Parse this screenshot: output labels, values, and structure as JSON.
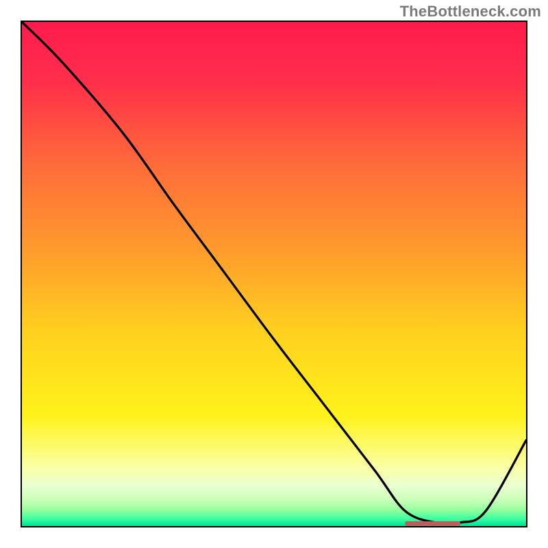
{
  "watermark": "TheBottleneck.com",
  "gradient": {
    "stops": [
      {
        "offset": "0%",
        "color": "#ff1a4d"
      },
      {
        "offset": "12%",
        "color": "#ff2f4a"
      },
      {
        "offset": "28%",
        "color": "#ff6a3a"
      },
      {
        "offset": "45%",
        "color": "#ff9a2d"
      },
      {
        "offset": "62%",
        "color": "#ffd21f"
      },
      {
        "offset": "78%",
        "color": "#fff21a"
      },
      {
        "offset": "88%",
        "color": "#fbffa0"
      },
      {
        "offset": "92%",
        "color": "#eaffd0"
      },
      {
        "offset": "95%",
        "color": "#c8ffb8"
      },
      {
        "offset": "97%",
        "color": "#8cff9c"
      },
      {
        "offset": "98.5%",
        "color": "#3effa0"
      },
      {
        "offset": "100%",
        "color": "#00e19a"
      }
    ]
  },
  "chart_data": {
    "type": "line",
    "title": "",
    "xlabel": "",
    "ylabel": "",
    "xlim": [
      0,
      100
    ],
    "ylim": [
      0,
      100
    ],
    "x": [
      0,
      8,
      20,
      30,
      40,
      50,
      60,
      70,
      76,
      82,
      87,
      92,
      100
    ],
    "values": [
      100,
      92,
      78,
      64,
      50.5,
      37,
      24,
      11,
      3,
      0.7,
      0.7,
      3,
      17
    ],
    "marker": {
      "x_start": 76,
      "x_end": 87,
      "y": 0.5,
      "color": "#c25a5a",
      "thickness_pct": 0.9
    },
    "annotations": []
  }
}
